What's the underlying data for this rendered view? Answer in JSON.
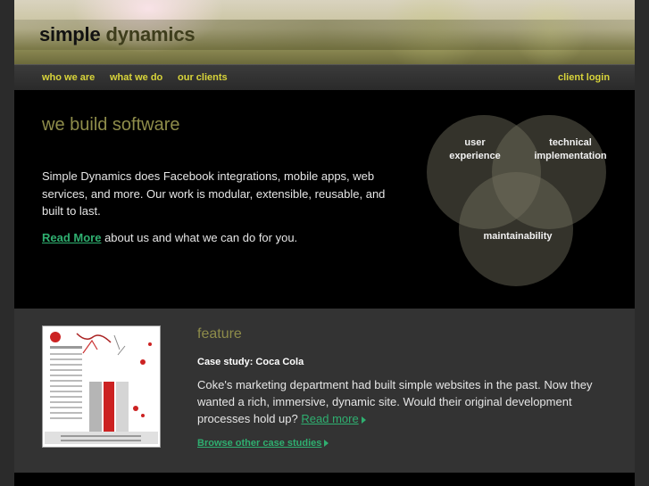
{
  "header": {
    "logo_part1": "simple",
    "logo_part2": "dynamics"
  },
  "nav": {
    "items": [
      "who we are",
      "what we do",
      "our clients"
    ],
    "login": "client login"
  },
  "hero": {
    "title": "we build software",
    "description": "Simple Dynamics does Facebook integrations, mobile apps, web services, and more. Our work is modular, extensible, reusable, and built to last.",
    "read_more": "Read More",
    "read_more_suffix": " about us and what we can do for you."
  },
  "venn": {
    "user_line1": "user",
    "user_line2": "experience",
    "tech_line1": "technical",
    "tech_line2": "implementation",
    "maintain": "maintainability"
  },
  "feature": {
    "heading": "feature",
    "case_title": "Case study: Coca Cola",
    "body": "Coke's marketing department had built simple websites in the past. Now they wanted a rich, immersive, dynamic site. Would their original development processes hold up?",
    "read_more": "Read more",
    "browse": "Browse other case studies"
  },
  "colors": {
    "accent_olive": "#8e8c4a",
    "link_green": "#2faf70",
    "nav_yellow": "#d8d43a"
  }
}
